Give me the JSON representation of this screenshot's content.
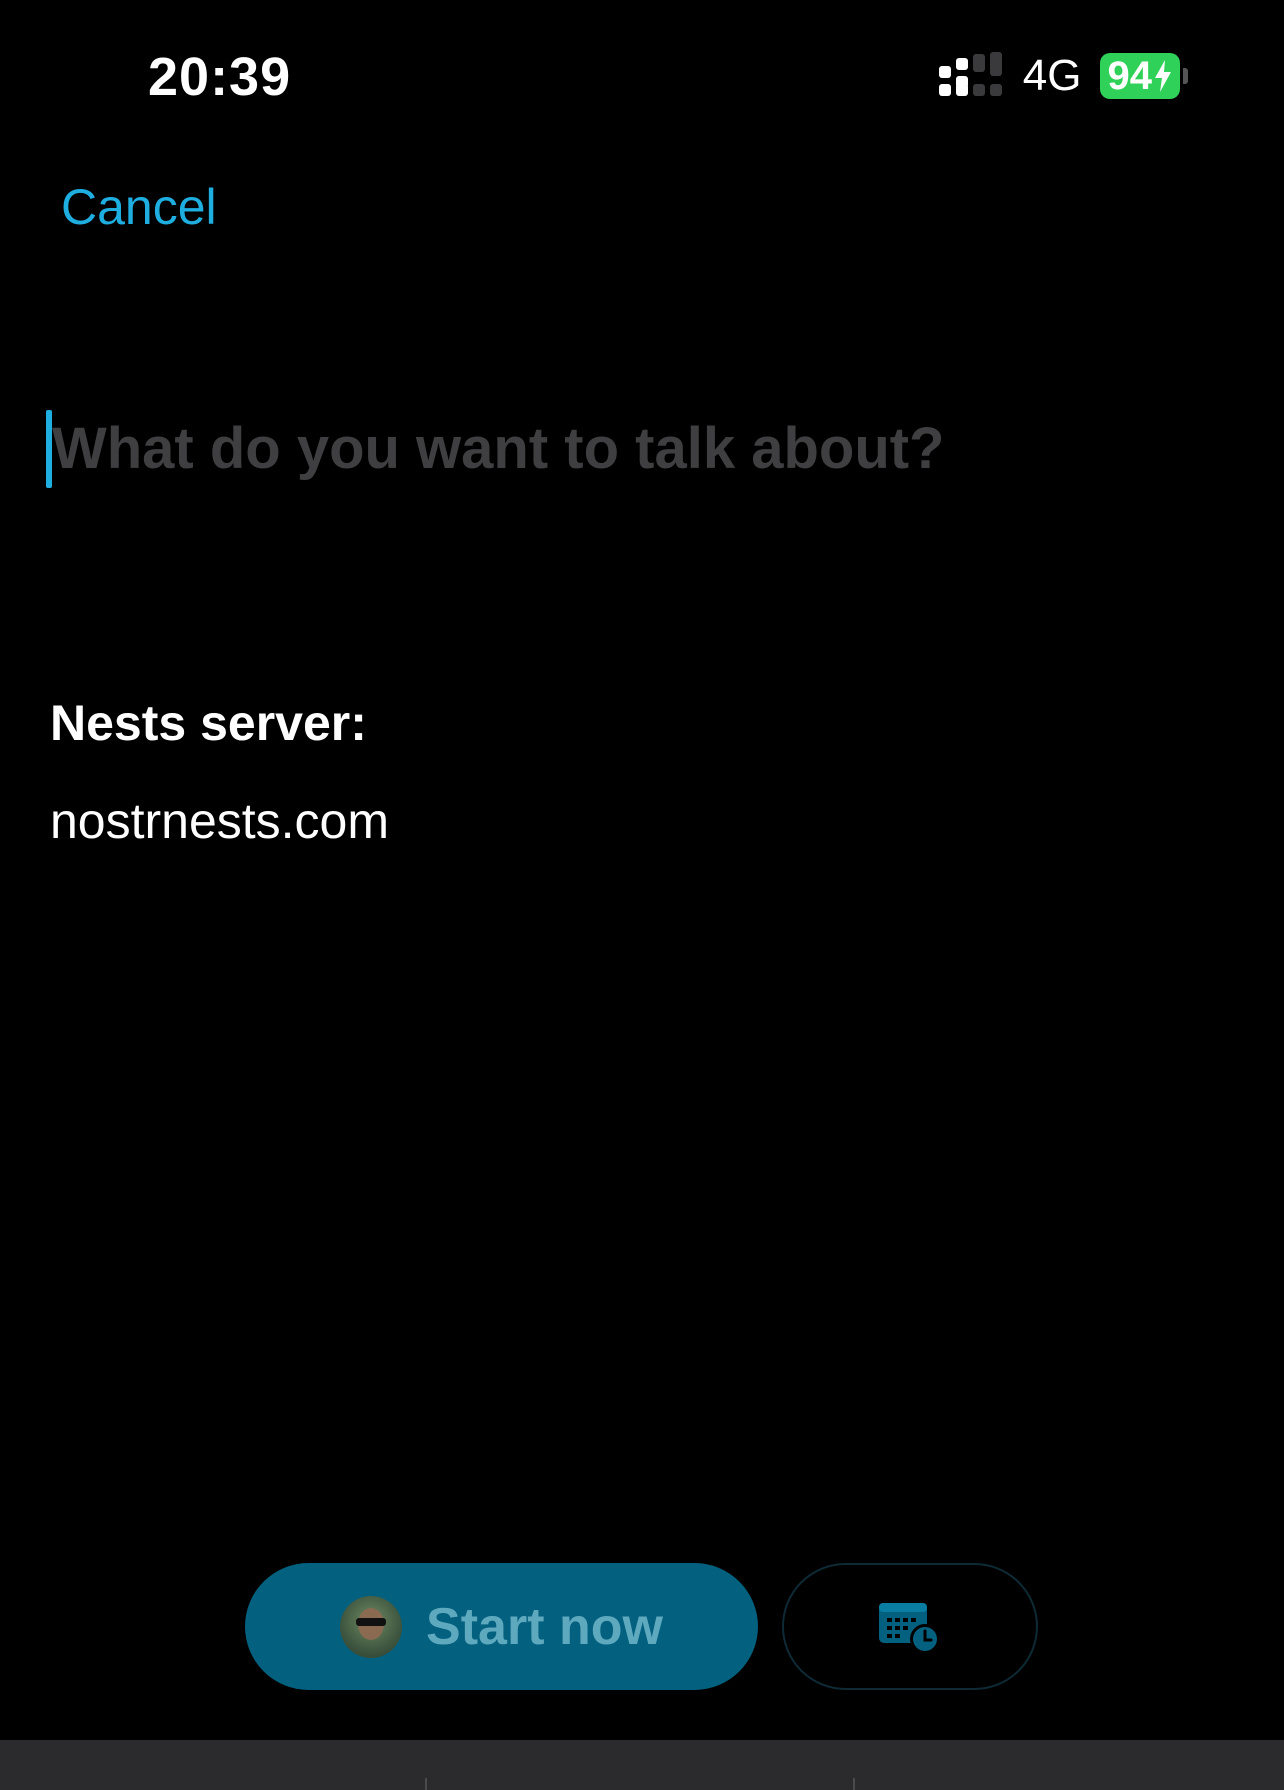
{
  "status_bar": {
    "time": "20:39",
    "network": "4G",
    "battery_percent": "94",
    "battery_charging": true,
    "battery_color": "#30d158",
    "signal_bars_active": 2,
    "signal_bars_total": 4
  },
  "header": {
    "cancel_label": "Cancel"
  },
  "topic": {
    "placeholder": "What do you want to talk about?",
    "value": ""
  },
  "server": {
    "label": "Nests server:",
    "value": "nostrnests.com"
  },
  "actions": {
    "start_label": "Start now",
    "schedule_icon": "calendar-clock-icon"
  },
  "colors": {
    "accent": "#1eaee0",
    "primary_button": "#03607e"
  }
}
